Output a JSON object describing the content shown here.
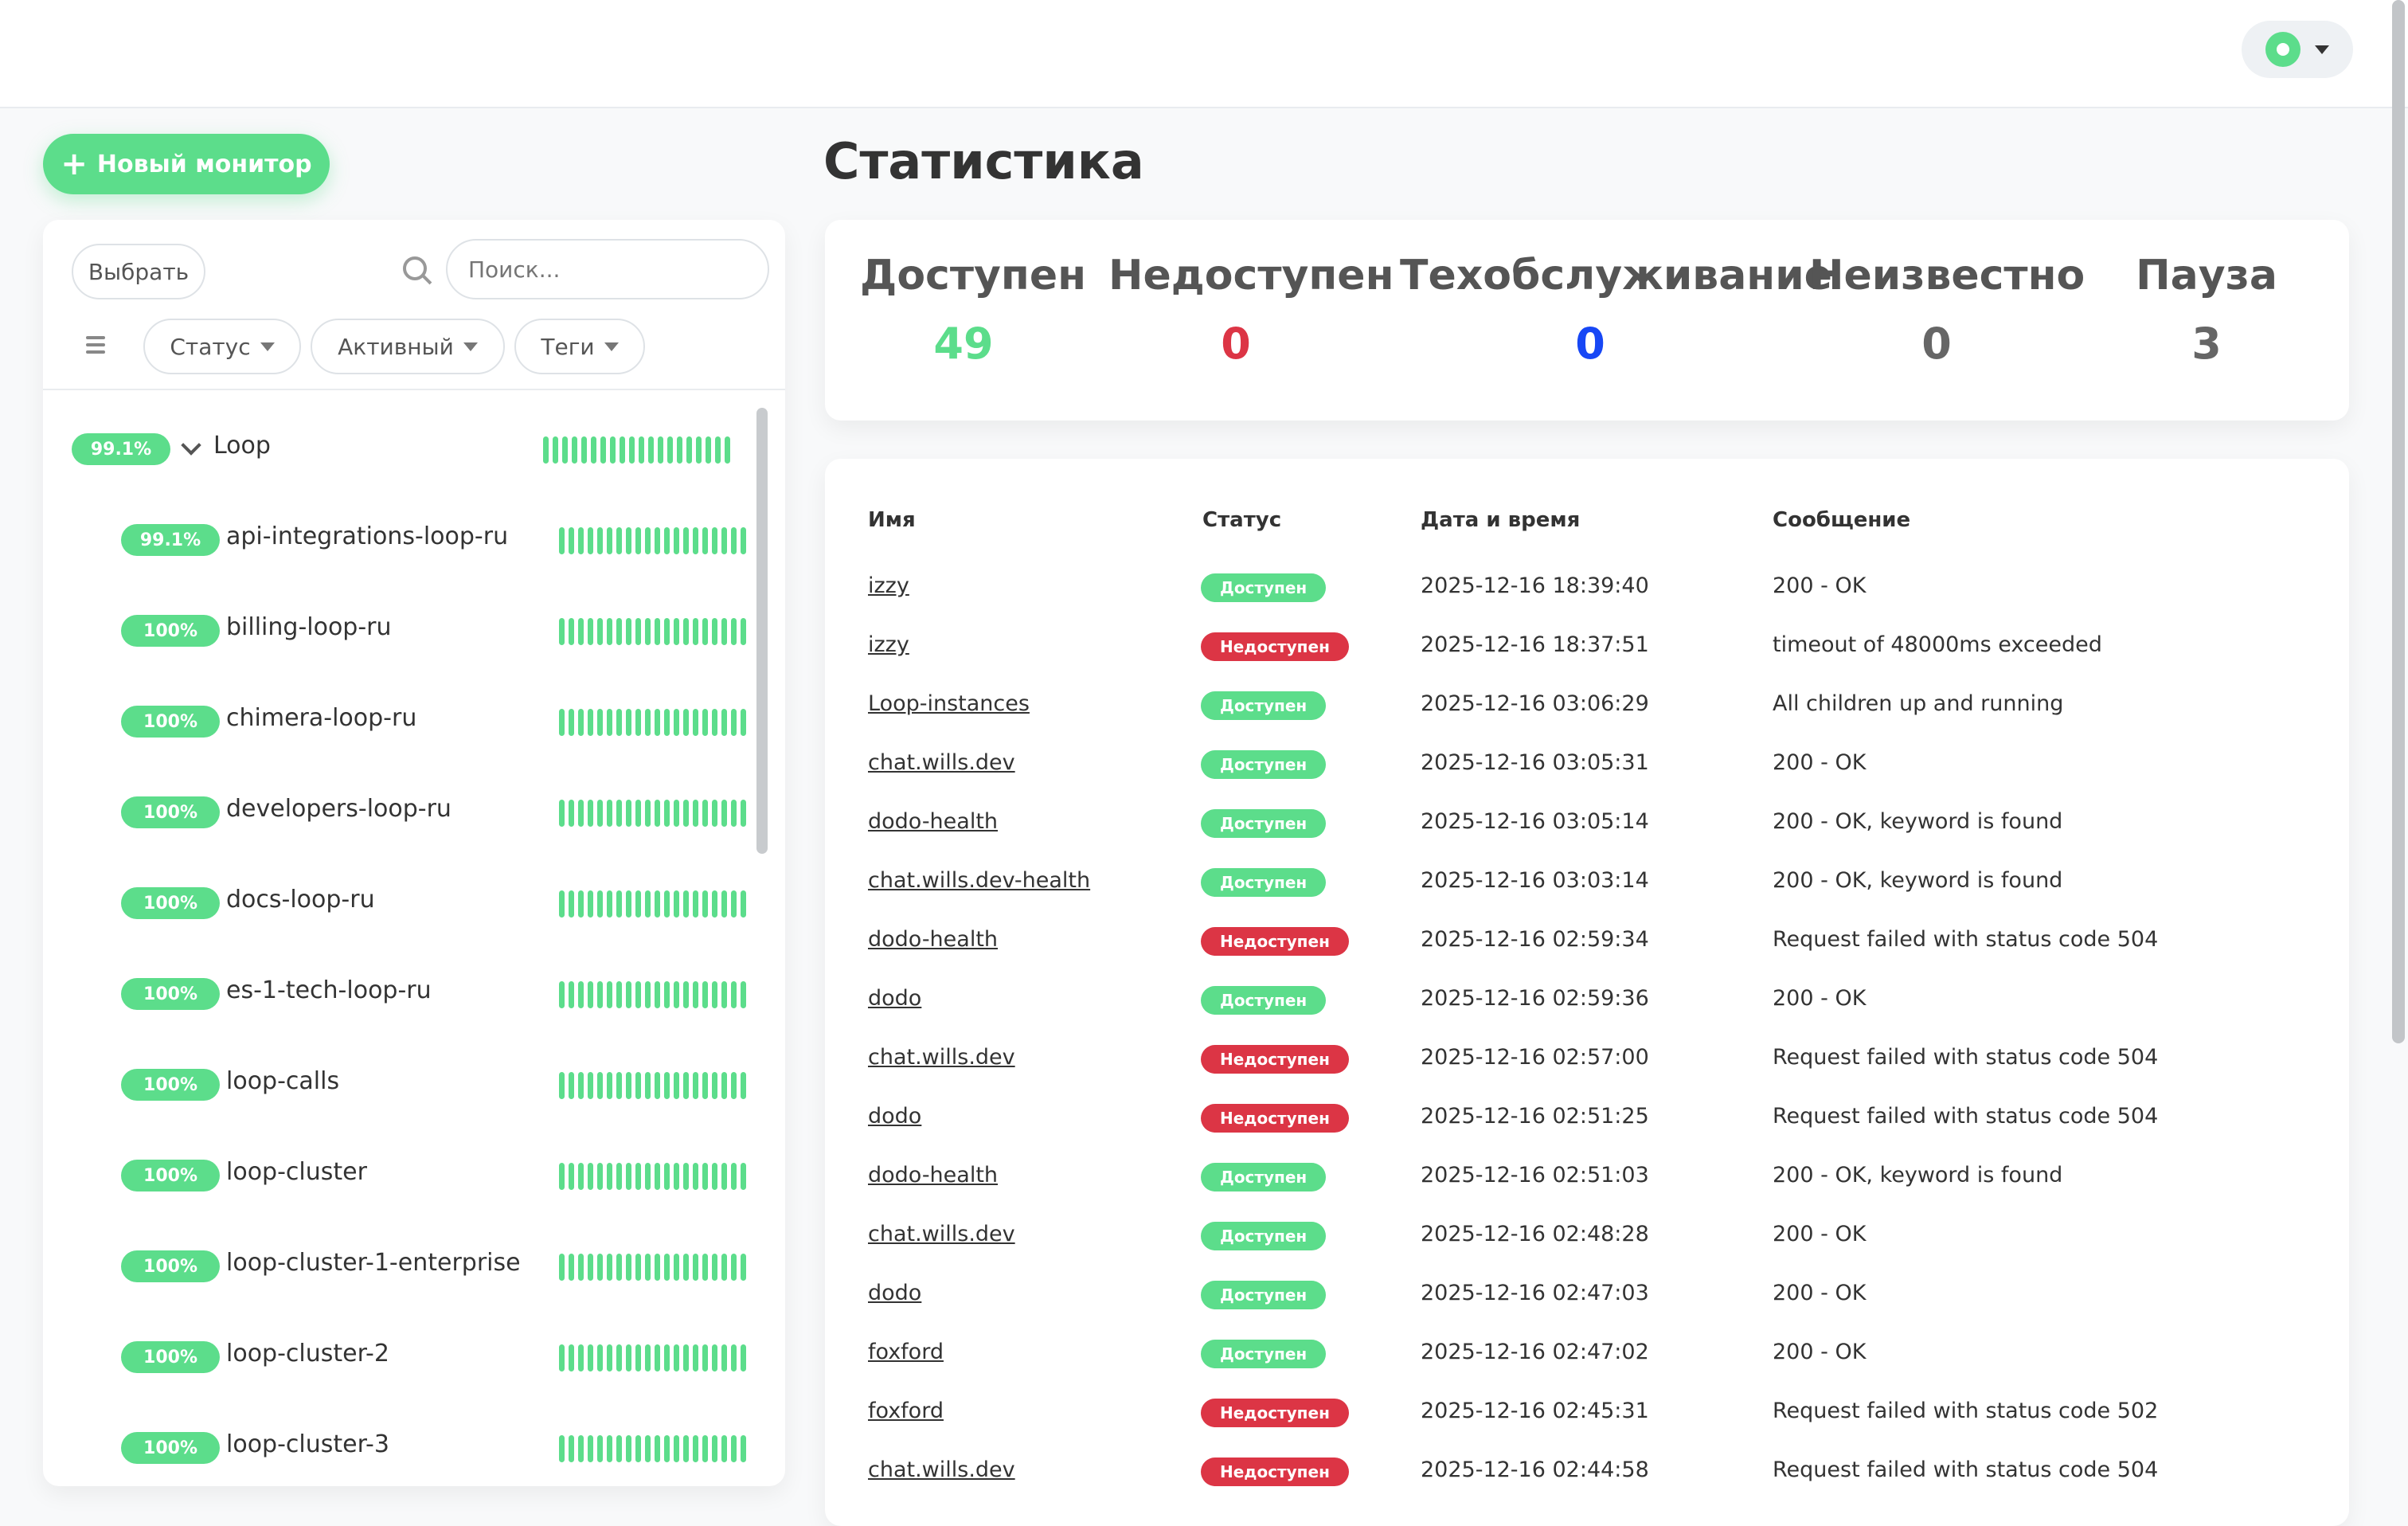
{
  "header": {
    "avatar_icon": "user-avatar-icon"
  },
  "actions": {
    "new_monitor_label": "Новый монитор"
  },
  "left_panel": {
    "select_label": "Выбрать",
    "search_placeholder": "Поиск...",
    "filters": [
      "Статус",
      "Активный",
      "Теги"
    ],
    "group": {
      "name": "Loop",
      "uptime": "99.1%"
    },
    "monitors": [
      {
        "name": "api-integrations-loop-ru",
        "uptime": "99.1%"
      },
      {
        "name": "billing-loop-ru",
        "uptime": "100%"
      },
      {
        "name": "chimera-loop-ru",
        "uptime": "100%"
      },
      {
        "name": "developers-loop-ru",
        "uptime": "100%"
      },
      {
        "name": "docs-loop-ru",
        "uptime": "100%"
      },
      {
        "name": "es-1-tech-loop-ru",
        "uptime": "100%"
      },
      {
        "name": "loop-calls",
        "uptime": "100%"
      },
      {
        "name": "loop-cluster",
        "uptime": "100%"
      },
      {
        "name": "loop-cluster-1-enterprise",
        "uptime": "100%"
      },
      {
        "name": "loop-cluster-2",
        "uptime": "100%"
      },
      {
        "name": "loop-cluster-3",
        "uptime": "100%"
      }
    ]
  },
  "stats": {
    "title": "Статистика",
    "items": [
      {
        "label": "Доступен",
        "value": "49"
      },
      {
        "label": "Недоступен",
        "value": "0"
      },
      {
        "label": "Техобслуживание",
        "value": "0"
      },
      {
        "label": "Неизвестно",
        "value": "0"
      },
      {
        "label": "Пауза",
        "value": "3"
      }
    ]
  },
  "events": {
    "columns": [
      "Имя",
      "Статус",
      "Дата и время",
      "Сообщение"
    ],
    "status_labels": {
      "up": "Доступен",
      "down": "Недоступен"
    },
    "rows": [
      {
        "name": "izzy",
        "status": "up",
        "time": "2025-12-16 18:39:40",
        "message": "200 - OK"
      },
      {
        "name": "izzy",
        "status": "down",
        "time": "2025-12-16 18:37:51",
        "message": "timeout of 48000ms exceeded"
      },
      {
        "name": "Loop-instances",
        "status": "up",
        "time": "2025-12-16 03:06:29",
        "message": "All children up and running"
      },
      {
        "name": "chat.wills.dev",
        "status": "up",
        "time": "2025-12-16 03:05:31",
        "message": "200 - OK"
      },
      {
        "name": "dodo-health",
        "status": "up",
        "time": "2025-12-16 03:05:14",
        "message": "200 - OK, keyword is found"
      },
      {
        "name": "chat.wills.dev-health",
        "status": "up",
        "time": "2025-12-16 03:03:14",
        "message": "200 - OK, keyword is found"
      },
      {
        "name": "dodo-health",
        "status": "down",
        "time": "2025-12-16 02:59:34",
        "message": "Request failed with status code 504"
      },
      {
        "name": "dodo",
        "status": "up",
        "time": "2025-12-16 02:59:36",
        "message": "200 - OK"
      },
      {
        "name": "chat.wills.dev",
        "status": "down",
        "time": "2025-12-16 02:57:00",
        "message": "Request failed with status code 504"
      },
      {
        "name": "dodo",
        "status": "down",
        "time": "2025-12-16 02:51:25",
        "message": "Request failed with status code 504"
      },
      {
        "name": "dodo-health",
        "status": "up",
        "time": "2025-12-16 02:51:03",
        "message": "200 - OK, keyword is found"
      },
      {
        "name": "chat.wills.dev",
        "status": "up",
        "time": "2025-12-16 02:48:28",
        "message": "200 - OK"
      },
      {
        "name": "dodo",
        "status": "up",
        "time": "2025-12-16 02:47:03",
        "message": "200 - OK"
      },
      {
        "name": "foxford",
        "status": "up",
        "time": "2025-12-16 02:47:02",
        "message": "200 - OK"
      },
      {
        "name": "foxford",
        "status": "down",
        "time": "2025-12-16 02:45:31",
        "message": "Request failed with status code 502"
      },
      {
        "name": "chat.wills.dev",
        "status": "down",
        "time": "2025-12-16 02:44:58",
        "message": "Request failed with status code 504"
      }
    ]
  },
  "colors": {
    "primary": "#5cdd8b",
    "danger": "#dc3545",
    "maintenance": "#1747f5"
  }
}
